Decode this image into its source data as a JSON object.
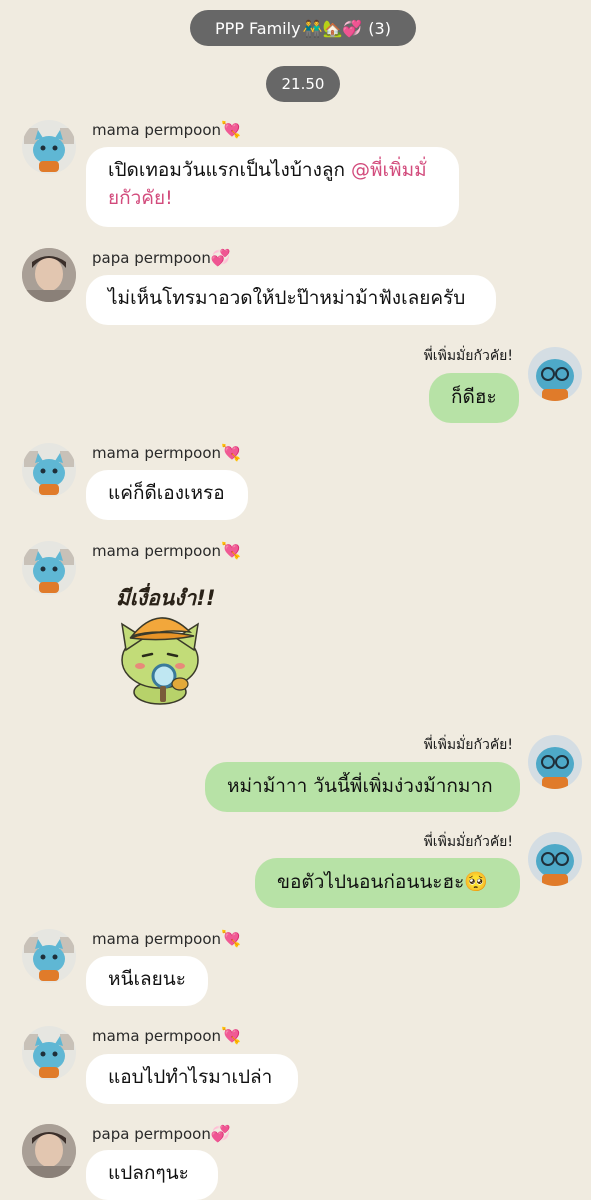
{
  "header": {
    "group_name": "PPP Family",
    "group_emojis": "👬🏡💞",
    "member_count": "(3)"
  },
  "time_divider": "21.50",
  "senders": {
    "mama": "mama permpoon",
    "mama_emoji": "💘",
    "papa": "papa permpoon",
    "papa_emoji": "💞",
    "me": "พี่เพิ่มมั่ยกัวคัย!"
  },
  "messages": [
    {
      "from": "mama",
      "text": "เปิดเทอมวันแรกเป็นไงบ้างลูก ",
      "mention": "@พี่เพิ่มมั่ยกัวคัย!"
    },
    {
      "from": "papa",
      "text": "ไม่เห็นโทรมาอวดให้ปะป๊าหม่าม้าฟังเลยครับ"
    },
    {
      "from": "me",
      "text": "ก็ดีฮะ"
    },
    {
      "from": "mama",
      "text": "แค่ก็ดีเองเหรอ"
    },
    {
      "from": "mama",
      "type": "sticker",
      "sticker_text": "มีเงื่อนงำ!!"
    },
    {
      "from": "me",
      "text": "หม่าม้าาา วันนี้พี่เพิ่มง่วงม้ากมาก"
    },
    {
      "from": "me",
      "text": "ขอตัวไปนอนก่อนนะฮะ",
      "emoji": "🥺"
    },
    {
      "from": "mama",
      "text": "หนีเลยนะ"
    },
    {
      "from": "mama",
      "text": "แอบไปทำไรมาเปล่า"
    },
    {
      "from": "papa",
      "text": "แปลกๆนะ"
    }
  ],
  "icons": {
    "mascot": "blue-cat-mascot-icon",
    "sticker": "detective-cat-sticker"
  }
}
